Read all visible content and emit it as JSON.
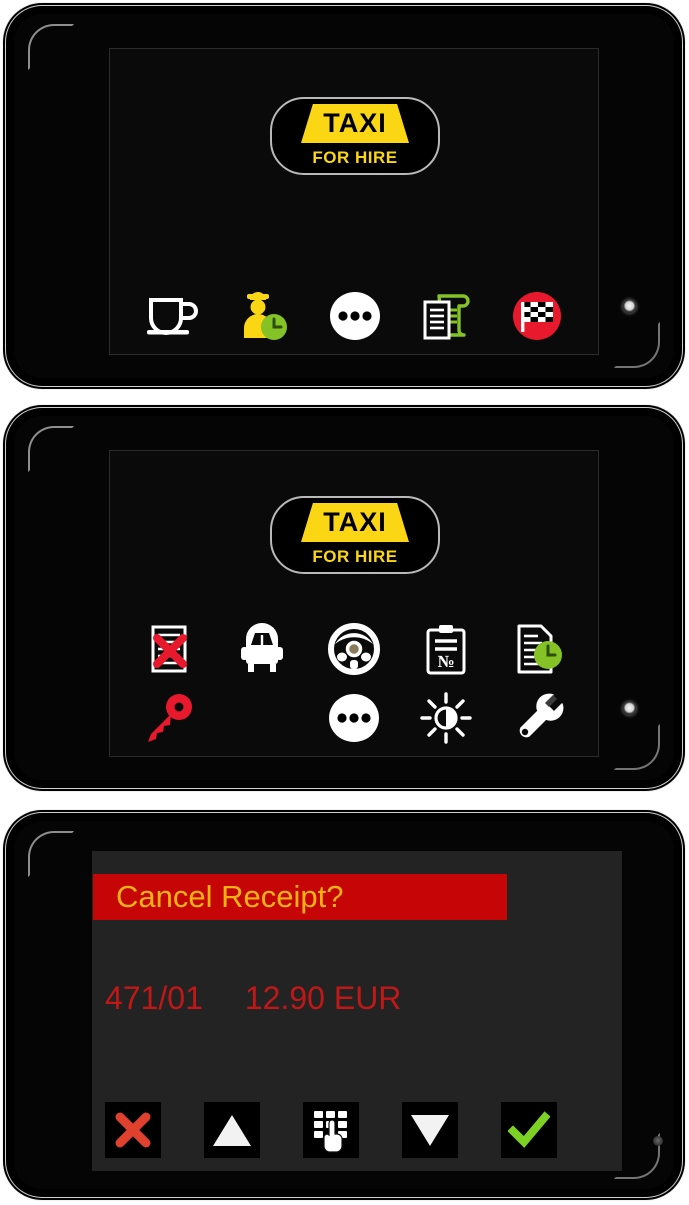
{
  "brand": {
    "taxi_label": "TAXI",
    "for_hire_label": "FOR HIRE",
    "sign_color": "#fbd614",
    "sign_border": "#b9b9b9"
  },
  "colors": {
    "device_body": "#000000",
    "device_outline": "#f2f2f2",
    "screen_bg": "#0a0a0a",
    "dialog_bg": "#232323",
    "header_red": "#c60606",
    "header_text": "#f5b312",
    "value_red": "#c21717",
    "accent_green": "#84c225",
    "accent_yellow": "#fbd614",
    "accent_red": "#e03030"
  },
  "screens": [
    {
      "id": "idle-screen",
      "name": "Idle / For Hire screen",
      "sign": {
        "taxi": "TAXI",
        "for_hire": "FOR HIRE"
      },
      "toolbar": [
        {
          "name": "break-coffee-button",
          "icon": "coffee-cup-icon",
          "label": "Break",
          "interactable": true
        },
        {
          "name": "driver-shift-button",
          "icon": "driver-clock-icon",
          "label": "Driver shift",
          "interactable": true
        },
        {
          "name": "more-options-button",
          "icon": "three-dots-icon",
          "label": "More",
          "interactable": true
        },
        {
          "name": "receipts-button",
          "icon": "receipt-scroll-icon",
          "label": "Receipts",
          "interactable": true
        },
        {
          "name": "end-shift-button",
          "icon": "checkered-flag-icon",
          "label": "End shift",
          "interactable": true
        }
      ]
    },
    {
      "id": "menu-screen",
      "name": "Main menu screen",
      "sign": {
        "taxi": "TAXI",
        "for_hire": "FOR HIRE"
      },
      "menu_row_1": [
        {
          "name": "cancel-receipt-button",
          "icon": "document-cancel-icon",
          "label": "Cancel receipt",
          "interactable": true
        },
        {
          "name": "vehicle-button",
          "icon": "car-front-icon",
          "label": "Vehicle",
          "interactable": true
        },
        {
          "name": "driving-mode-button",
          "icon": "steering-wheel-icon",
          "label": "Driving",
          "interactable": true
        },
        {
          "name": "trip-number-button",
          "icon": "clipboard-number-icon",
          "label": "Trip number",
          "interactable": true
        },
        {
          "name": "shift-report-button",
          "icon": "document-clock-icon",
          "label": "Shift report",
          "interactable": true
        }
      ],
      "menu_row_2": [
        {
          "name": "login-key-button",
          "icon": "key-icon",
          "label": "Login",
          "interactable": true
        },
        {
          "name": "empty-slot",
          "icon": "",
          "label": "",
          "interactable": false
        },
        {
          "name": "more-options-button",
          "icon": "three-dots-icon",
          "label": "More",
          "interactable": true
        },
        {
          "name": "brightness-button",
          "icon": "brightness-sun-icon",
          "label": "Brightness",
          "interactable": true
        },
        {
          "name": "service-button",
          "icon": "wrench-icon",
          "label": "Service",
          "interactable": true
        }
      ]
    },
    {
      "id": "cancel-receipt-screen",
      "name": "Cancel receipt confirmation",
      "dialog": {
        "title": "Cancel Receipt?",
        "receipt_number": "471/01",
        "amount": "12.90 EUR"
      },
      "buttons": [
        {
          "name": "cancel-button",
          "icon": "cross-icon",
          "label": "Cancel",
          "interactable": true
        },
        {
          "name": "scroll-up-button",
          "icon": "triangle-up-icon",
          "label": "Up",
          "interactable": true
        },
        {
          "name": "keypad-button",
          "icon": "keypad-hand-icon",
          "label": "Keypad",
          "interactable": true
        },
        {
          "name": "scroll-down-button",
          "icon": "triangle-down-icon",
          "label": "Down",
          "interactable": true
        },
        {
          "name": "confirm-button",
          "icon": "check-icon",
          "label": "Confirm",
          "interactable": true
        }
      ]
    }
  ]
}
